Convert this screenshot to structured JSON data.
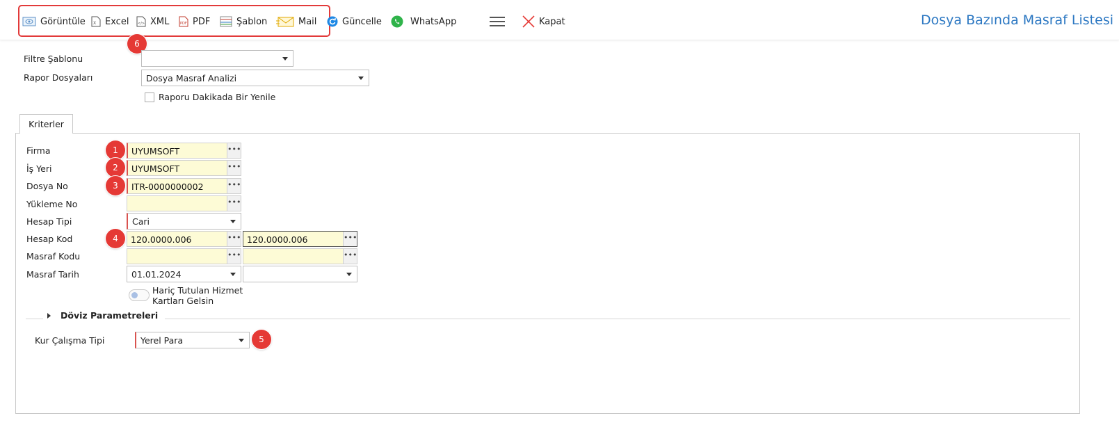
{
  "toolbar": {
    "items": [
      {
        "label": "Görüntüle",
        "icon": "view-icon"
      },
      {
        "label": "Excel",
        "icon": "excel-icon"
      },
      {
        "label": "XML",
        "icon": "xml-icon"
      },
      {
        "label": "PDF",
        "icon": "pdf-icon"
      },
      {
        "label": "Şablon",
        "icon": "template-icon"
      },
      {
        "label": "Mail",
        "icon": "mail-icon"
      },
      {
        "label": "Güncelle",
        "icon": "refresh-icon"
      },
      {
        "label": "WhatsApp",
        "icon": "whatsapp-icon"
      },
      {
        "label": "",
        "icon": "hamburger-menu-icon"
      },
      {
        "label": "Kapat",
        "icon": "close-icon"
      }
    ],
    "title": "Dosya Bazında Masraf Listesi"
  },
  "badges": [
    "1",
    "2",
    "3",
    "4",
    "5",
    "6"
  ],
  "top_form": {
    "filter_template": {
      "label": "Filtre Şablonu",
      "value": ""
    },
    "report_files": {
      "label": "Rapor Dosyaları",
      "value": "Dosya Masraf Analizi"
    },
    "refresh_checkbox": {
      "label": "Raporu Dakikada Bir Yenile",
      "checked": false
    }
  },
  "tabs": [
    {
      "label": "Kriterler",
      "active": true
    }
  ],
  "criteria": {
    "firma": {
      "label": "Firma",
      "value": "UYUMSOFT"
    },
    "is_yeri": {
      "label": "İş Yeri",
      "value": "UYUMSOFT"
    },
    "dosya_no": {
      "label": "Dosya No",
      "value": "ITR-0000000002"
    },
    "yukleme_no": {
      "label": "Yükleme No",
      "value": ""
    },
    "hesap_tipi": {
      "label": "Hesap Tipi",
      "value": "Cari"
    },
    "hesap_kod": {
      "label": "Hesap Kod",
      "from": "120.0000.006",
      "to": "120.0000.006"
    },
    "masraf_kodu": {
      "label": "Masraf Kodu",
      "from": "",
      "to": ""
    },
    "masraf_tarih": {
      "label": "Masraf Tarih",
      "from": "01.01.2024",
      "to": ""
    },
    "exclude_toggle": {
      "label_line1": "Hariç Tutulan Hizmet",
      "label_line2": "Kartları Gelsin",
      "on": false
    }
  },
  "currency_section": {
    "title": "Döviz Parametreleri",
    "rate_type": {
      "label": "Kur Çalışma Tipi",
      "value": "Yerel Para"
    }
  },
  "colors": {
    "accent_title": "#2b77c2",
    "badge": "#e53935",
    "field_bg": "#fdfbd6",
    "required_marker": "#d9534f"
  }
}
